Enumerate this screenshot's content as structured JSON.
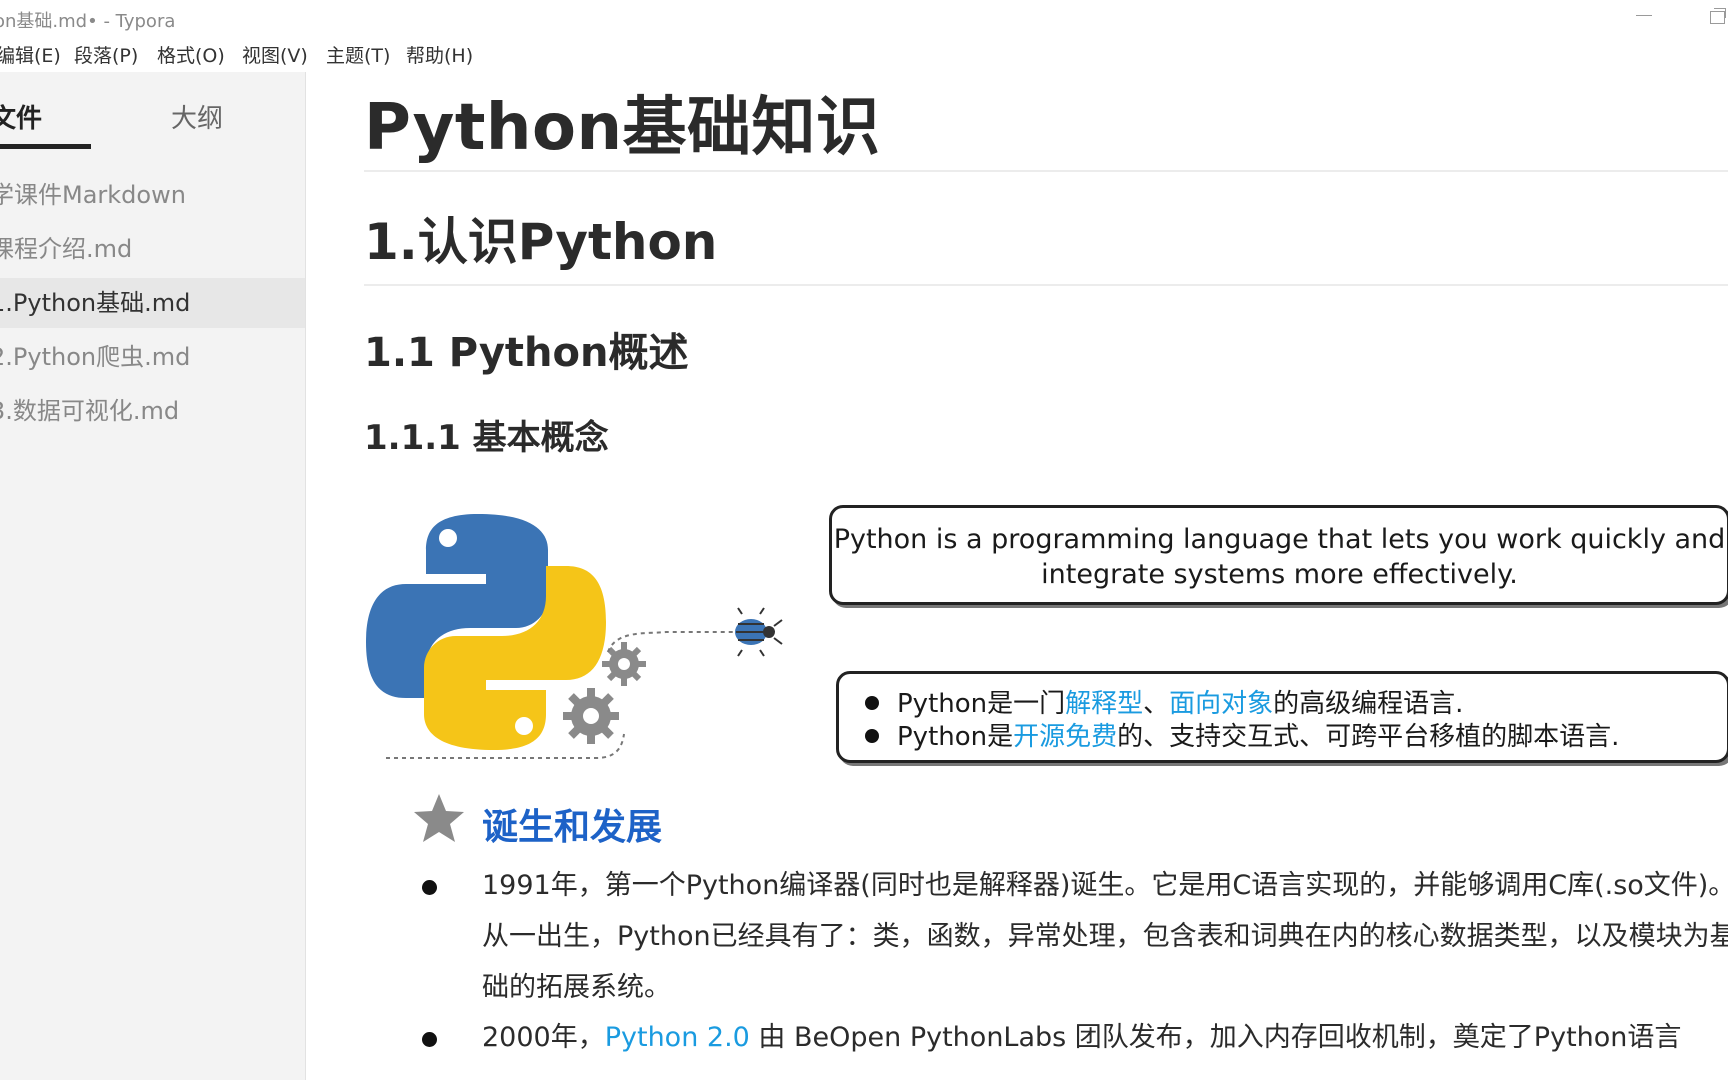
{
  "window": {
    "title": "on基础.md• - Typora"
  },
  "menu": [
    {
      "label": "编辑(E)",
      "x": 0
    },
    {
      "label": "段落(P)",
      "x": 0
    },
    {
      "label": "格式(O)",
      "x": 0
    },
    {
      "label": "视图(V)",
      "x": 0
    },
    {
      "label": "主题(T)",
      "x": 0
    },
    {
      "label": "帮助(H)",
      "x": 0
    }
  ],
  "sidebar": {
    "tabs": {
      "files": "文件",
      "outline": "大纲"
    },
    "files": [
      {
        "label": "学课件Markdown"
      },
      {
        "label": "课程介绍.md"
      },
      {
        "label": "1.Python基础.md"
      },
      {
        "label": "2.Python爬虫.md"
      },
      {
        "label": "3.数据可视化.md"
      }
    ]
  },
  "doc": {
    "h1": "Python基础知识",
    "h2": "1.认识Python",
    "h3": "1.1 Python概述",
    "h4": "1.1.1 基本概念",
    "quote": "Python is a programming language that lets you work quickly and integrate systems more effectively.",
    "bullet1": {
      "a": "Python是一门",
      "b": "解释型",
      "c": "、",
      "d": "面向对象",
      "e": "的高级编程语言."
    },
    "bullet2": {
      "a": "Python是",
      "b": "开源免费",
      "c": "的、支持交互式、可跨平台移植的脚本语言."
    },
    "section_title": "诞生和发展",
    "item1": "1991年，第一个Python编译器(同时也是解释器)诞生。它是用C语言实现的，并能够调用C库(.so文件)。从一出生，Python已经具有了：类，函数，异常处理，包含表和词典在内的核心数据类型，以及模块为基础的拓展系统。",
    "item2": {
      "a": "2000年，",
      "link": "Python 2.0",
      "b": " 由 BeOpen PythonLabs 团队发布，加入内存回收机制，奠定了Python语言"
    }
  },
  "colors": {
    "accent_link": "#1a9be0",
    "section_blue": "#1d62c7",
    "python_blue": "#3b74b5",
    "python_yellow": "#f5c518"
  }
}
